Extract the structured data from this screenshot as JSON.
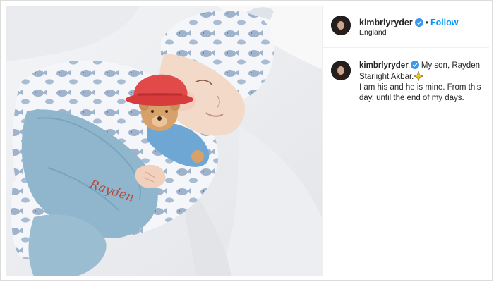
{
  "post": {
    "username": "kimbrlyryder",
    "location": "England",
    "follow_label": "Follow",
    "separator": "•",
    "caption_line1": "My son, Rayden Starlight Akbar.",
    "caption_line2": "I am his and he is mine. From this day, until the end of my days.",
    "blanket_embroidery": "Rayden"
  },
  "colors": {
    "verified": "#3897f0",
    "follow": "#0095f6",
    "text": "#262626"
  },
  "icons": {
    "verified": "verified-badge-icon",
    "sparkle": "sparkle-emoji-icon"
  }
}
